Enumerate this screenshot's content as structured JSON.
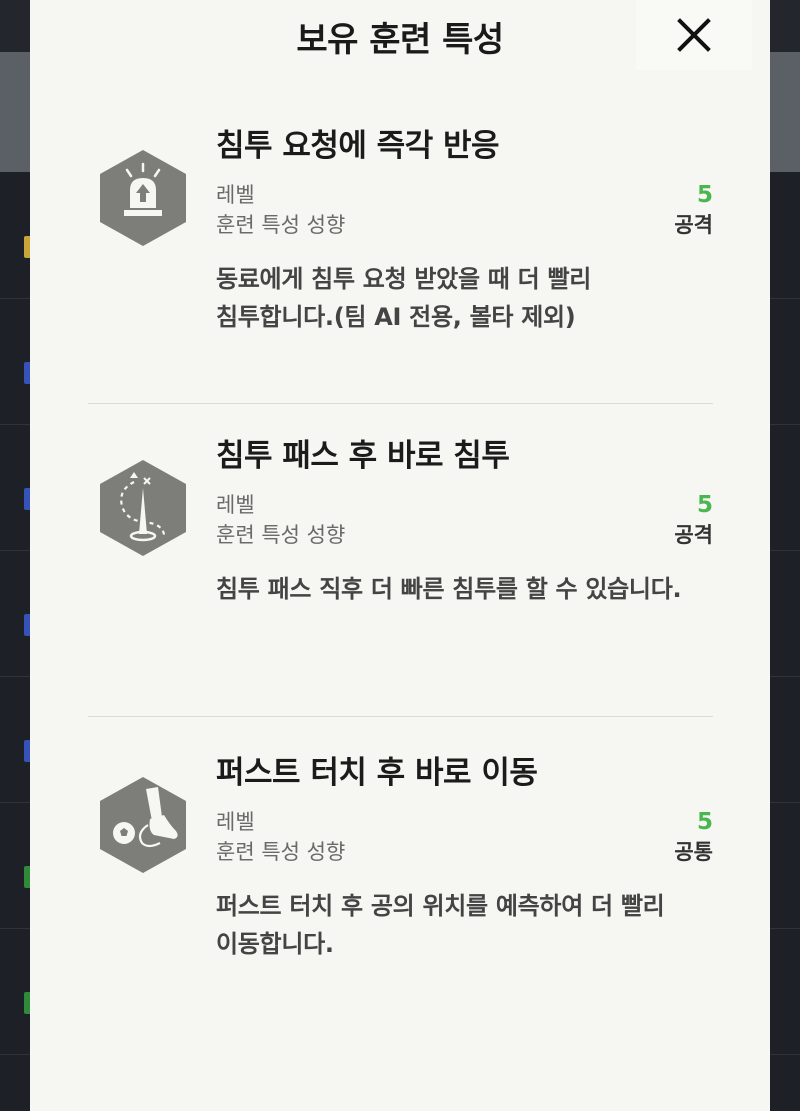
{
  "modal": {
    "title": "보유 훈련 특성"
  },
  "labels": {
    "level": "레벨",
    "tendency": "훈련 특성 성향"
  },
  "traits": [
    {
      "name": "침투 요청에 즉각 반응",
      "level": "5",
      "tendency": "공격",
      "description_lines": [
        "동료에게 침투 요청 받았을 때 더 빨리",
        "침투합니다.(팀 AI 전용, 볼타 제외)"
      ],
      "icon": "siren-icon"
    },
    {
      "name": "침투 패스 후 바로 침투",
      "level": "5",
      "tendency": "공격",
      "description_lines": [
        "침투 패스 직후 더 빠른 침투를 할 수 있습니다."
      ],
      "icon": "run-path-icon"
    },
    {
      "name": "퍼스트 터치 후 바로 이동",
      "level": "5",
      "tendency": "공통",
      "description_lines": [
        "퍼스트 터치 후 공의 위치를 예측하여 더 빨리",
        "이동합니다."
      ],
      "icon": "ball-kick-icon"
    }
  ],
  "colors": {
    "level_green": "#4ab650",
    "icon_gray": "#7d7d79",
    "modal_bg": "#f6f6f2"
  }
}
